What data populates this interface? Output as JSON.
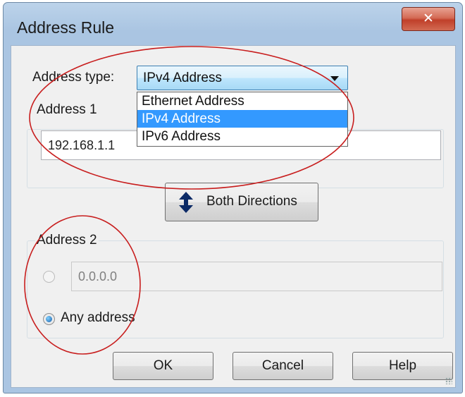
{
  "window": {
    "title": "Address Rule",
    "close_glyph": "✕"
  },
  "address_type": {
    "label": "Address type:",
    "selected": "IPv4 Address",
    "options": [
      "Ethernet Address",
      "IPv4 Address",
      "IPv6 Address"
    ]
  },
  "address1": {
    "group_label": "Address 1",
    "value": "192.168.1.1"
  },
  "direction_button": {
    "label": "Both Directions",
    "icon": "up-down-arrow-icon"
  },
  "address2": {
    "group_label": "Address 2",
    "value": "0.0.0.0",
    "any_label": "Any address",
    "selected_option": "any"
  },
  "buttons": {
    "ok": "OK",
    "cancel": "Cancel",
    "help": "Help"
  },
  "annotation_color": "#c81e1e"
}
